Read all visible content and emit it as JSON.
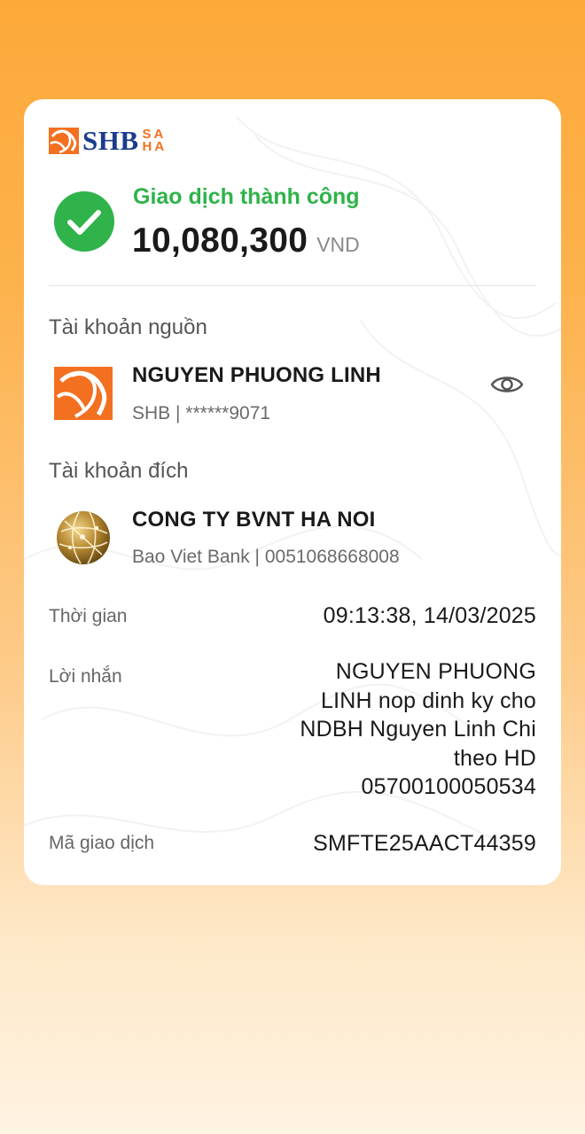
{
  "brand": {
    "name": "SHB",
    "sub_top": "SA",
    "sub_bottom": "HA",
    "color_primary": "#1B3C8C",
    "color_accent": "#F37021"
  },
  "status": {
    "text": "Giao dịch thành công",
    "icon": "check-circle-icon",
    "color": "#2FB34A"
  },
  "amount": {
    "value": "10,080,300",
    "currency": "VND"
  },
  "source": {
    "label": "Tài khoản nguồn",
    "name": "NGUYEN PHUONG LINH",
    "bank_account": "SHB | ******9071",
    "logo": "shb-logo-icon",
    "action_icon": "eye-icon"
  },
  "destination": {
    "label": "Tài khoản đích",
    "name": "CONG TY BVNT HA NOI",
    "bank_account": "Bao Viet Bank | 0051068668008",
    "logo": "bao-viet-globe-icon"
  },
  "details": {
    "time_label": "Thời gian",
    "time_value": "09:13:38, 14/03/2025",
    "message_label": "Lời nhắn",
    "message_lines": [
      "NGUYEN PHUONG",
      "LINH nop dinh ky cho",
      "NDBH Nguyen Linh Chi",
      "theo HD",
      "05700100050534"
    ],
    "transaction_label": "Mã giao dịch",
    "transaction_value": "SMFTE25AACT44359"
  }
}
